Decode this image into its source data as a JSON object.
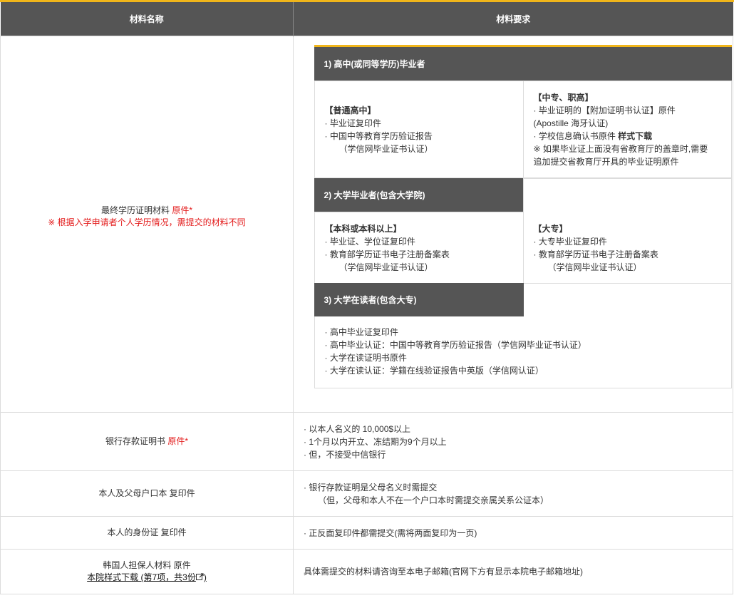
{
  "header": {
    "col_name": "材料名称",
    "col_req": "材料要求"
  },
  "education": {
    "name_label": "最终学历证明材料",
    "name_flag": "原件*",
    "name_note": "※ 根据入学申请者个人学历情况，需提交的材料不同",
    "sec1_title": "1) 高中(或同等学历)毕业者",
    "general_title": "【普通高中】",
    "general_lines": [
      "· 毕业证复印件",
      "· 中国中等教育学历验证报告",
      "（学信网毕业证书认证）"
    ],
    "voc_title": "【中专、职高】",
    "voc_lines": [
      "· 毕业证明的【附加证明书认证】原件",
      "(Apostille 海牙认证)"
    ],
    "voc_line3_prefix": "· 学校信息确认书原件 ",
    "voc_line3_link": "样式下载",
    "voc_notes": [
      "※ 如果毕业证上面没有省教育厅的盖章时,需要",
      "追加提交省教育厅开具的毕业证明原件"
    ],
    "sec2_title": "2) 大学毕业者(包含大学院)",
    "bachelor_title": "【本科或本科以上】",
    "bachelor_lines": [
      "· 毕业证、学位证复印件",
      "· 教育部学历证书电子注册备案表",
      "（学信网毕业证书认证）"
    ],
    "college_title": "【大专】",
    "college_lines": [
      "· 大专毕业证复印件",
      "· 教育部学历证书电子注册备案表",
      "（学信网毕业证书认证）"
    ],
    "sec3_title": "3) 大学在读者(包含大专)",
    "enrolled_lines": [
      "· 高中毕业证复印件",
      "· 高中毕业认证：中国中等教育学历验证报告（学信网毕业证书认证）",
      "· 大学在读证明书原件",
      "· 大学在读认证：学籍在线验证报告中英版（学信网认证）"
    ]
  },
  "bank": {
    "name_label": "银行存款证明书",
    "name_flag": "原件*",
    "lines": [
      "· 以本人名义的 10,000$以上",
      "· 1个月以内开立、冻结期为9个月以上",
      "· 但，不接受中信银行"
    ]
  },
  "hukou": {
    "name_label": "本人及父母户口本 复印件",
    "lines": [
      "· 银行存款证明是父母名义时需提交",
      "（但，父母和本人不在一个户口本时需提交亲属关系公证本）"
    ]
  },
  "idcard": {
    "name_label": "本人的身份证 复印件",
    "lines": [
      "· 正反面复印件都需提交(需将两面复印为一页)"
    ]
  },
  "guarantor": {
    "name_label": "韩国人担保人材料 原件",
    "name_link": "本院样式下载 (第7项，共3份",
    "name_link_icon": "external-link-icon",
    "name_link_close": ")",
    "req_text": "具体需提交的材料请咨询至本电子邮箱(官网下方有显示本院电子邮箱地址)"
  },
  "colors": {
    "accent": "#f0b51a",
    "header_bg": "#555555",
    "flag": "#e31a1a"
  }
}
